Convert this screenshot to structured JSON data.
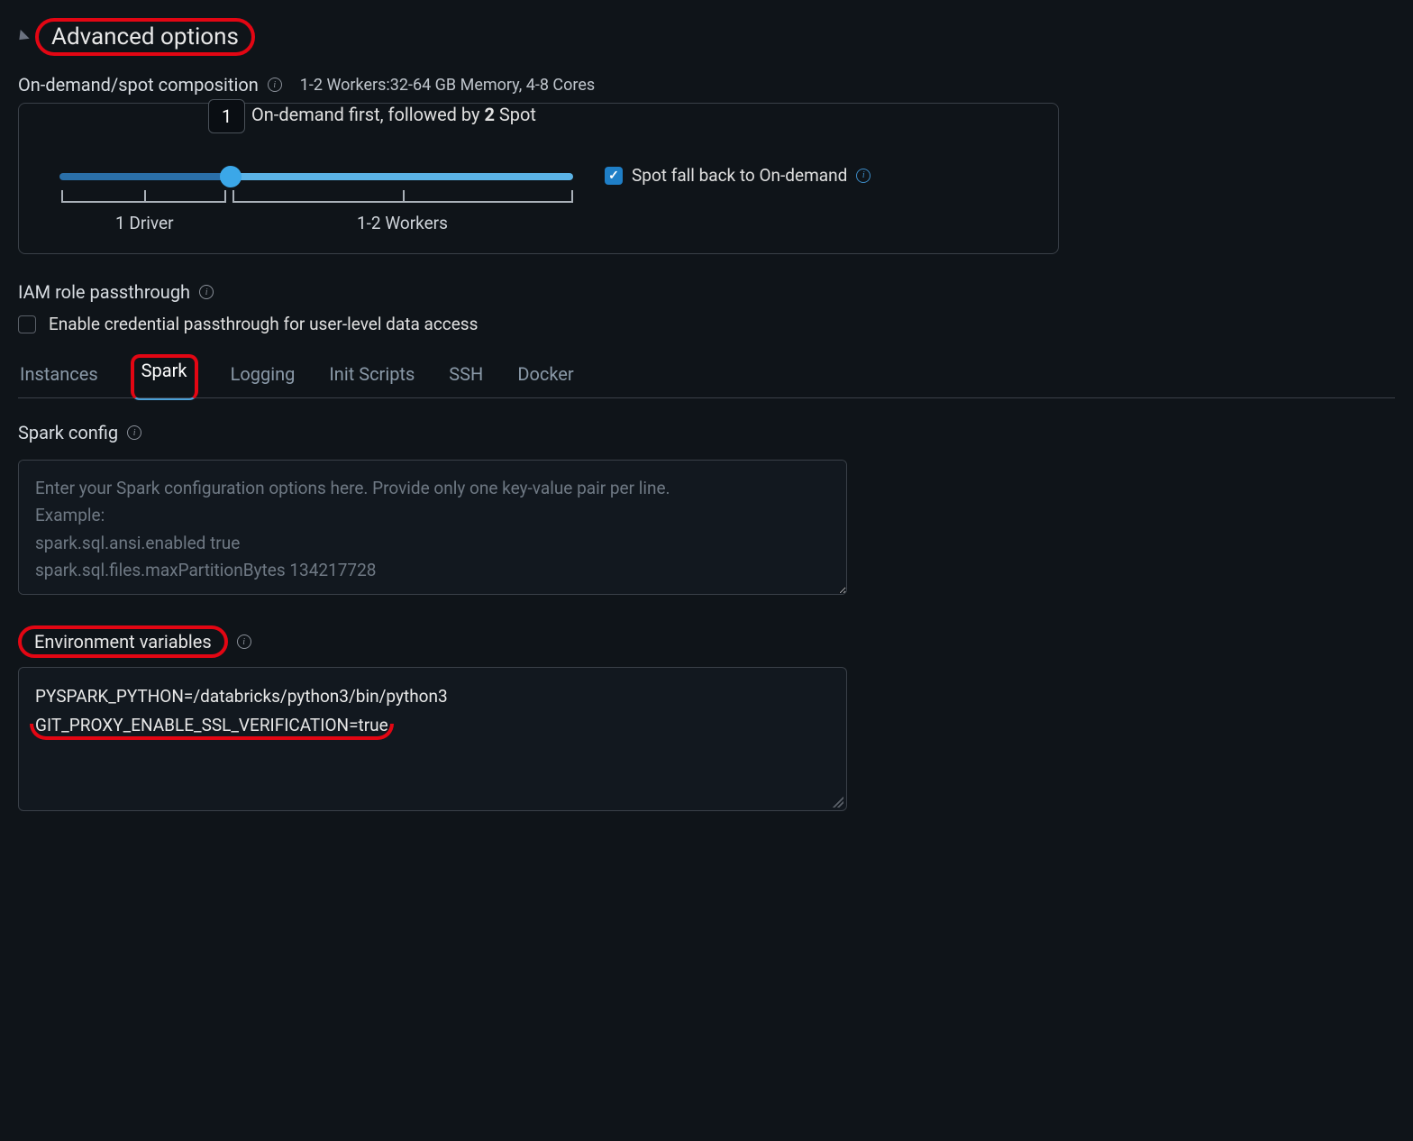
{
  "header": {
    "title": "Advanced options"
  },
  "composition": {
    "label": "On-demand/spot composition",
    "summary": "1-2 Workers:32-64 GB Memory, 4-8 Cores",
    "tooltip_value": "1",
    "tooltip_text_prefix": "On-demand first, followed by ",
    "tooltip_text_bold": "2",
    "tooltip_text_suffix": " Spot",
    "bracket_driver": "1 Driver",
    "bracket_workers": "1-2 Workers",
    "fallback_label": "Spot fall back to On-demand"
  },
  "iam": {
    "label": "IAM role passthrough",
    "checkbox_label": "Enable credential passthrough for user-level data access"
  },
  "tabs": {
    "instances": "Instances",
    "spark": "Spark",
    "logging": "Logging",
    "init": "Init Scripts",
    "ssh": "SSH",
    "docker": "Docker"
  },
  "spark_config": {
    "label": "Spark config",
    "placeholder": "Enter your Spark configuration options here. Provide only one key-value pair per line.\nExample:\nspark.sql.ansi.enabled true\nspark.sql.files.maxPartitionBytes 134217728"
  },
  "env_vars": {
    "label": "Environment variables",
    "line1": "PYSPARK_PYTHON=/databricks/python3/bin/python3",
    "line2": "GIT_PROXY_ENABLE_SSL_VERIFICATION=true"
  }
}
